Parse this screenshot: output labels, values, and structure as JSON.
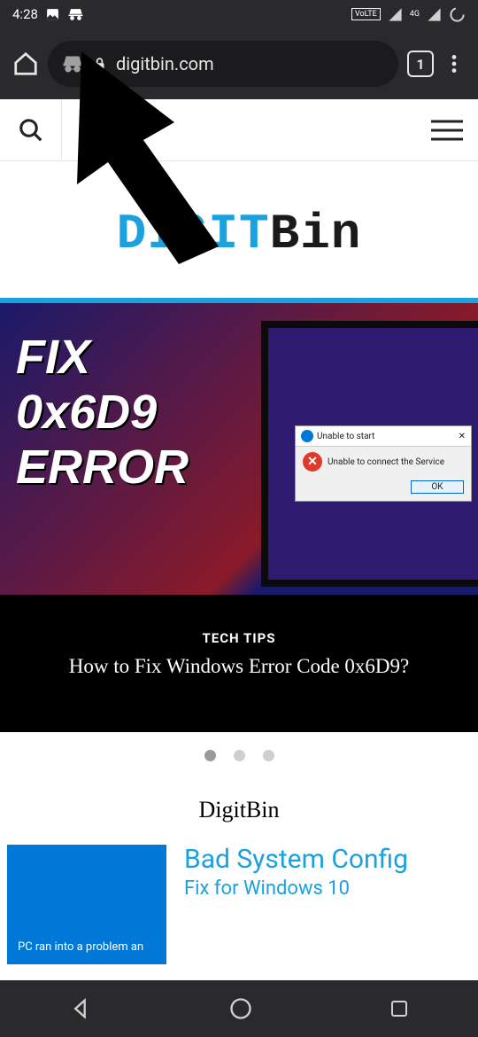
{
  "status": {
    "time": "4:28",
    "volte": "VoLTE"
  },
  "browser": {
    "url": "digitbin.com",
    "tabs": "1"
  },
  "logo": {
    "part1": "DIGIT",
    "part2": "Bin"
  },
  "hero": {
    "fix_line1": "FIX",
    "fix_line2": "0x6D9",
    "fix_line3": "ERROR",
    "dialog_title": "Unable to start",
    "dialog_msg": "Unable to connect the Service",
    "ok": "OK",
    "category": "TECH TIPS",
    "headline": "How to Fix Windows Error Code 0x6D9?"
  },
  "section": {
    "title": "DigitBin"
  },
  "post": {
    "thumb_text": "PC ran into a problem an",
    "title": "Bad System Config",
    "subtitle": "Fix for Windows 10"
  }
}
